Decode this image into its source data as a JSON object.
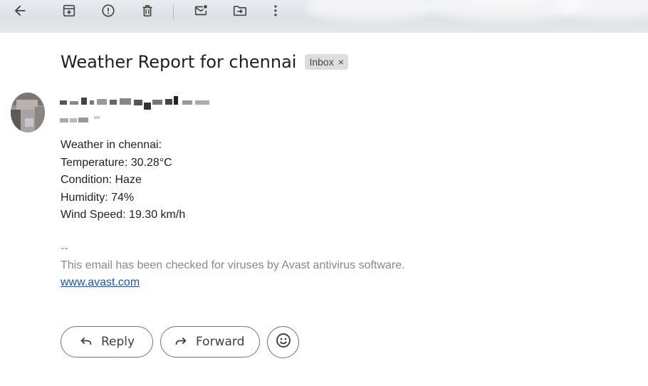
{
  "toolbar": {
    "icons": [
      "back-arrow-icon",
      "archive-icon",
      "report-spam-icon",
      "delete-icon",
      "mark-unread-icon",
      "move-to-icon",
      "more-options-icon"
    ]
  },
  "email": {
    "subject": "Weather Report for chennai",
    "label": "Inbox",
    "label_remove": "×",
    "body_lines": [
      "Weather in chennai:",
      "Temperature: 30.28°C",
      "Condition: Haze",
      "Humidity: 74%",
      "Wind Speed: 19.30 km/h"
    ],
    "signature_separator": "--",
    "signature_text": "This email has been checked for viruses by Avast antivirus software.",
    "signature_link": "www.avast.com"
  },
  "actions": {
    "reply_label": "Reply",
    "forward_label": "Forward"
  },
  "colors": {
    "link": "#1155cc",
    "signature_gray": "#888888",
    "chip_background": "#dddddd"
  }
}
